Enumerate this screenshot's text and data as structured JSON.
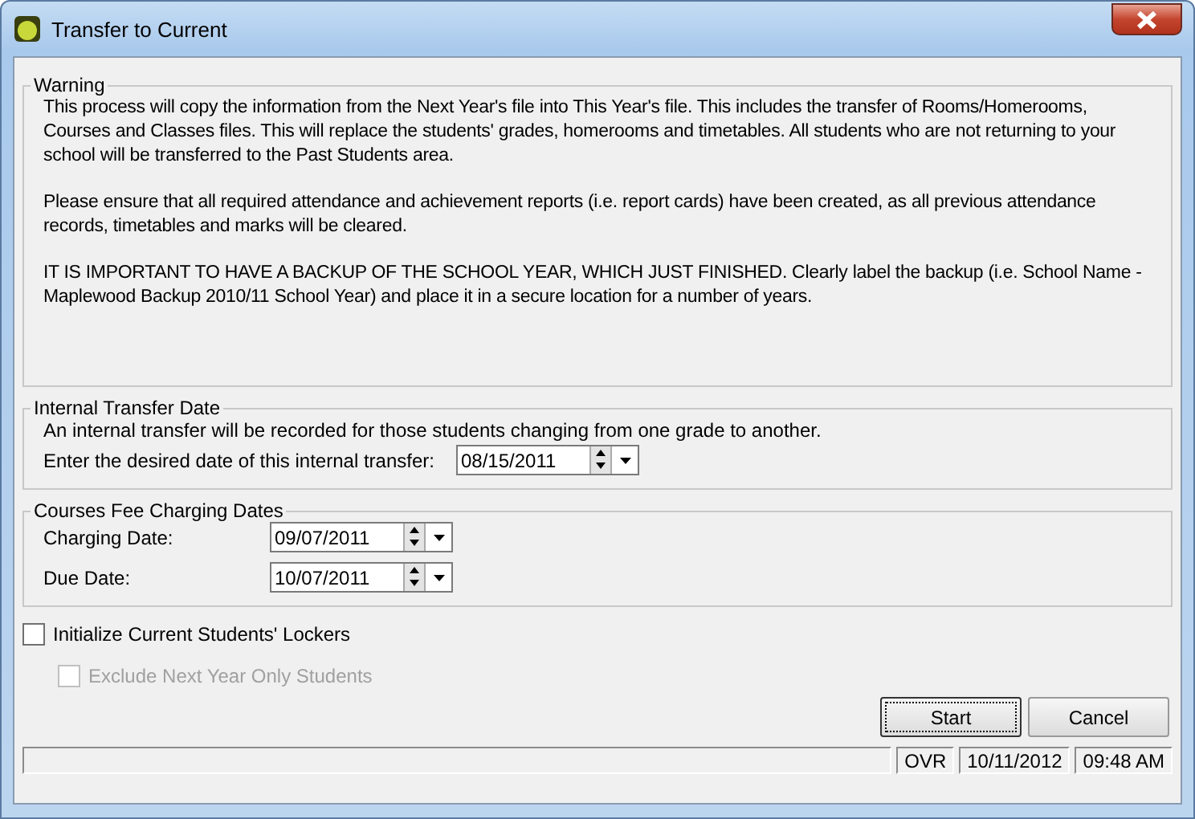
{
  "window": {
    "title": "Transfer to Current"
  },
  "warning": {
    "legend": "Warning",
    "paragraphs": [
      "This process will copy the information from the Next Year's file into This Year's file. This includes the transfer of Rooms/Homerooms, Courses and Classes files. This will replace the students' grades, homerooms and timetables. All students who are not returning to your school will be transferred to the Past Students area.",
      "Please ensure that all required attendance and achievement reports (i.e. report cards) have been created, as all previous attendance records, timetables and marks will be cleared.",
      "IT IS IMPORTANT TO HAVE A BACKUP OF THE SCHOOL YEAR, WHICH JUST FINISHED. Clearly label the backup (i.e. School Name - Maplewood Backup 2010/11 School Year) and place it in a secure location for a number of years."
    ]
  },
  "internal_transfer": {
    "legend": "Internal Transfer Date",
    "note": "An internal transfer will be recorded for those students changing from one grade to another.",
    "label": "Enter the desired date of this internal transfer:",
    "value": "08/15/2011"
  },
  "fee_dates": {
    "legend": "Courses Fee Charging Dates",
    "fields": [
      {
        "label": "Charging Date:",
        "value": "09/07/2011"
      },
      {
        "label": "Due Date:",
        "value": "10/07/2011"
      }
    ]
  },
  "options": [
    {
      "label": "Initialize Current Students' Lockers",
      "checked": false,
      "disabled": false
    },
    {
      "label": "Exclude Next Year Only Students",
      "checked": false,
      "disabled": true
    }
  ],
  "buttons": [
    {
      "label": "Start",
      "default": true
    },
    {
      "label": "Cancel",
      "default": false
    }
  ],
  "status_bar": [
    "OVR",
    "10/11/2012",
    "09:48 AM"
  ]
}
